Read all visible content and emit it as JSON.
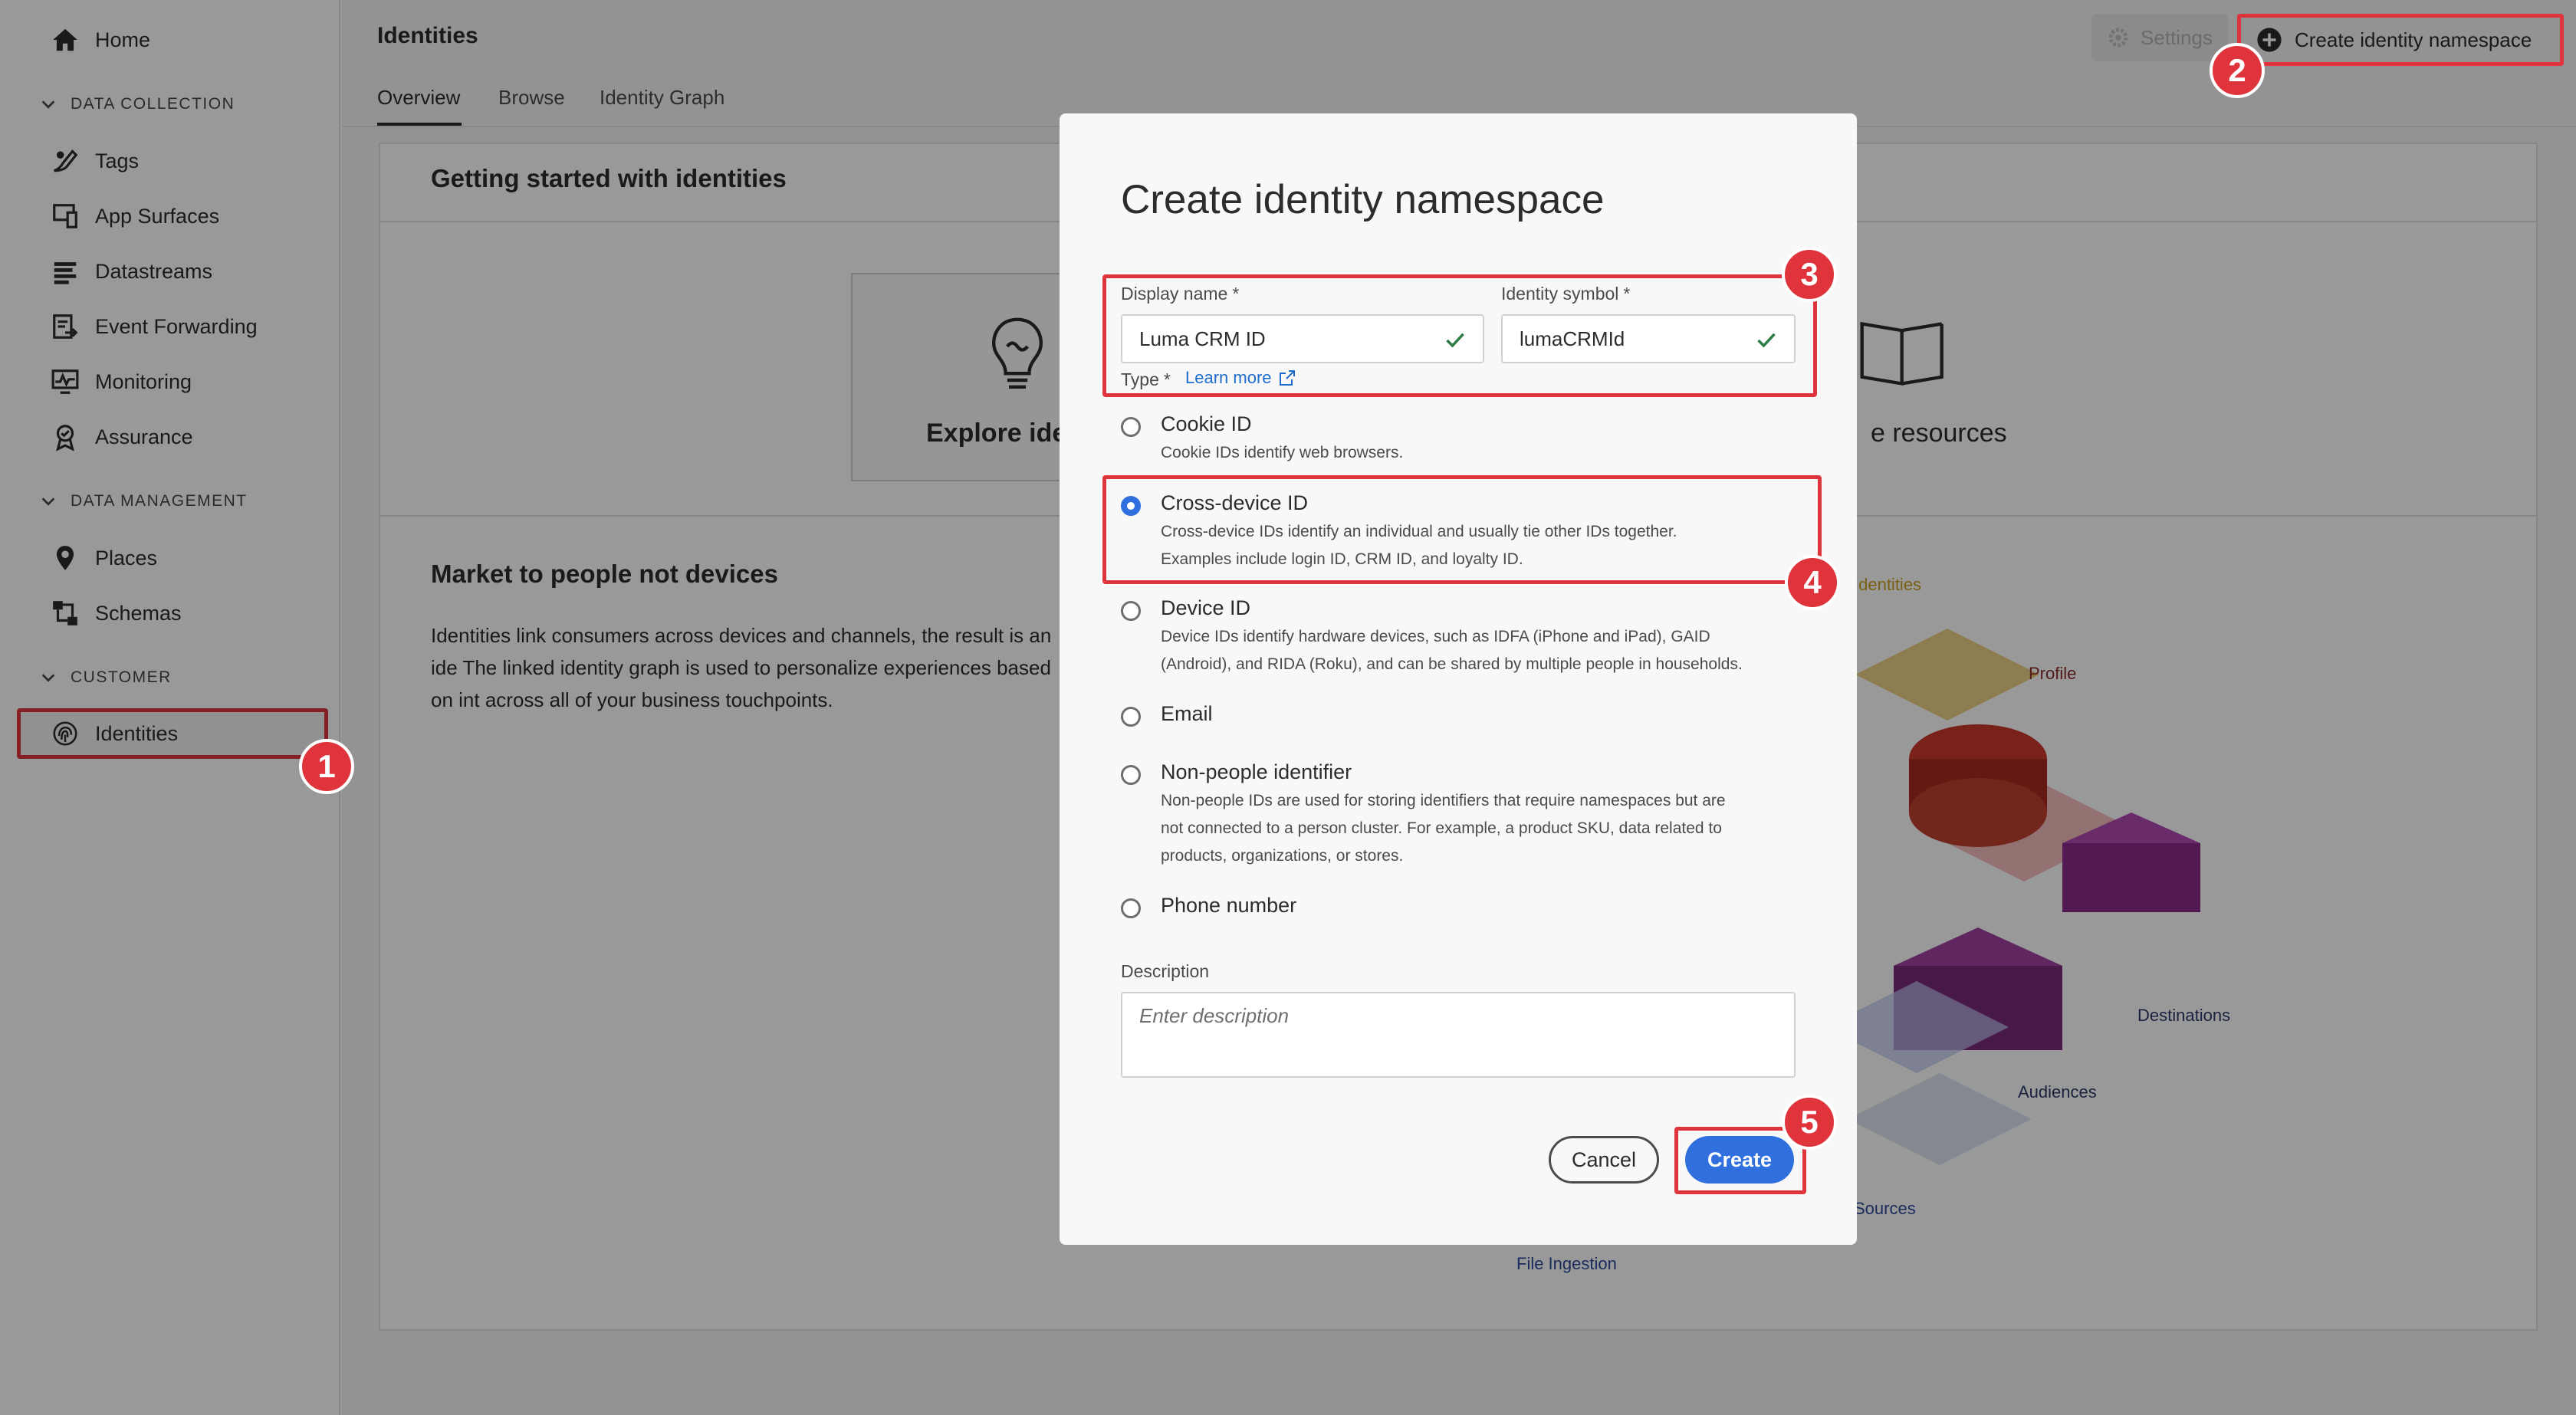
{
  "sidebar": {
    "home": "Home",
    "sections": {
      "data_collection": "DATA COLLECTION",
      "data_management": "DATA MANAGEMENT",
      "customer": "CUSTOMER"
    },
    "items": {
      "tags": "Tags",
      "app_surfaces": "App Surfaces",
      "datastreams": "Datastreams",
      "event_forwarding": "Event Forwarding",
      "monitoring": "Monitoring",
      "assurance": "Assurance",
      "places": "Places",
      "schemas": "Schemas",
      "identities": "Identities"
    }
  },
  "header": {
    "title": "Identities",
    "tabs": [
      "Overview",
      "Browse",
      "Identity Graph"
    ],
    "settings": "Settings",
    "create_namespace": "Create identity namespace"
  },
  "background": {
    "getting_started": "Getting started with identities",
    "explore": "Explore ide",
    "resources": "e resources",
    "market_title": "Market to people not devices",
    "market_body": "Identities link consumers across devices and channels, the result is an ide The linked identity graph is used to personalize experiences based on int across all of your business touchpoints.",
    "graph_labels": {
      "identities": "Identities",
      "profile": "Profile",
      "destinations": "Destinations",
      "audiences": "Audiences",
      "sources": "Sources",
      "file_ingestion": "File Ingestion"
    }
  },
  "modal": {
    "title": "Create identity namespace",
    "display_name_label": "Display name",
    "display_name_value": "Luma CRM ID",
    "identity_symbol_label": "Identity symbol",
    "identity_symbol_value": "lumaCRMId",
    "required_mark": "*",
    "type_label": "Type",
    "learn_more": "Learn more",
    "types": [
      {
        "label": "Cookie ID",
        "desc": "Cookie IDs identify web browsers."
      },
      {
        "label": "Cross-device ID",
        "desc1": "Cross-device IDs identify an individual and usually tie other IDs together.",
        "desc2": "Examples include login ID, CRM ID, and loyalty ID."
      },
      {
        "label": "Device ID",
        "desc1": "Device IDs identify hardware devices, such as IDFA (iPhone and iPad), GAID",
        "desc2": "(Android), and RIDA (Roku), and can be shared by multiple people in households."
      },
      {
        "label": "Email"
      },
      {
        "label": "Non-people identifier",
        "desc1": "Non-people IDs are used for storing identifiers that require namespaces but are",
        "desc2": "not connected to a person cluster. For example, a product SKU, data related to",
        "desc3": "products, organizations, or stores."
      },
      {
        "label": "Phone number"
      }
    ],
    "selected_type": "Cross-device ID",
    "description_label": "Description",
    "description_placeholder": "Enter description",
    "cancel": "Cancel",
    "create": "Create"
  },
  "callouts": [
    "1",
    "2",
    "3",
    "4",
    "5"
  ],
  "colors": {
    "callout_red": "#e0343c",
    "accent_blue": "#2f6fde",
    "link_blue": "#1e6ccc",
    "check_green": "#2d7d46"
  }
}
